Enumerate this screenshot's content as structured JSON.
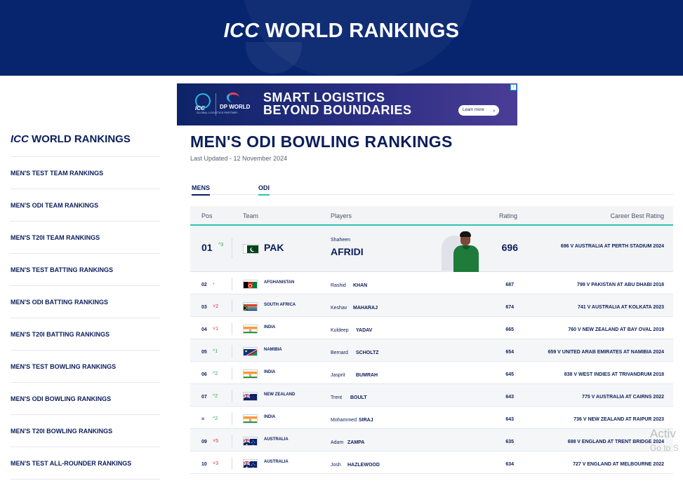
{
  "header": {
    "title_italic": "ICC",
    "title_rest": " WORLD RANKINGS"
  },
  "ad": {
    "icc_logo_text": "ICC",
    "dp_logo_text": "DP WORLD",
    "partner_text": "GLOBAL LOGISTICS PARTNER",
    "headline_1": "SMART LOGISTICS",
    "headline_2": "BEYOND BOUNDARIES",
    "button_label": "Learn more",
    "brand_colors": {
      "navy": "#0d2467",
      "purple": "#4b3d96",
      "cyan": "#35b3e6",
      "red": "#e0435f"
    }
  },
  "sidebar": {
    "title_italic": "ICC",
    "title_rest": " WORLD RANKINGS",
    "items": [
      {
        "label": "MEN'S TEST TEAM RANKINGS"
      },
      {
        "label": "MEN'S ODI TEAM RANKINGS"
      },
      {
        "label": "MEN'S T20I TEAM RANKINGS"
      },
      {
        "label": "MEN'S TEST BATTING RANKINGS"
      },
      {
        "label": "MEN'S ODI BATTING RANKINGS"
      },
      {
        "label": "MEN'S T20I BATTING RANKINGS"
      },
      {
        "label": "MEN'S TEST BOWLING RANKINGS"
      },
      {
        "label": "MEN'S ODI BOWLING RANKINGS"
      },
      {
        "label": "MEN'S T20I BOWLING RANKINGS"
      },
      {
        "label": "MEN'S TEST ALL-ROUNDER RANKINGS"
      }
    ]
  },
  "main": {
    "title": "MEN'S ODI BOWLING RANKINGS",
    "updated": "Last Updated - 12 November 2024",
    "filters": [
      {
        "label": "MENS"
      },
      {
        "label": "ODI"
      }
    ],
    "columns": {
      "pos": "Pos",
      "team": "Team",
      "players": "Players",
      "rating": "Rating",
      "career": "Career Best Rating"
    },
    "top": {
      "pos": "01",
      "move": "3",
      "move_dir": "up",
      "team": "PAK",
      "flag": "pakistan",
      "first": "Shaheen",
      "last": "AFRIDI",
      "rating": "696",
      "career": "696 V AUSTRALIA AT PERTH STADIUM 2024"
    },
    "rows": [
      {
        "pos": "02",
        "move": "",
        "move_dir": "none",
        "team": "AFGHANISTAN",
        "flag": "afghanistan",
        "first": "Rashid",
        "last": "KHAN",
        "rating": "687",
        "career": "799 V PAKISTAN AT ABU DHABI 2018"
      },
      {
        "pos": "03",
        "move": "2",
        "move_dir": "down",
        "team": "SOUTH AFRICA",
        "flag": "south-africa",
        "first": "Keshav",
        "last": "MAHARAJ",
        "rating": "674",
        "career": "741 V AUSTRALIA AT KOLKATA 2023"
      },
      {
        "pos": "04",
        "move": "1",
        "move_dir": "down",
        "team": "INDIA",
        "flag": "india",
        "first": "Kuldeep",
        "last": "YADAV",
        "rating": "665",
        "career": "760 V NEW ZEALAND AT BAY OVAL 2019"
      },
      {
        "pos": "05",
        "move": "1",
        "move_dir": "up",
        "team": "NAMIBIA",
        "flag": "namibia",
        "first": "Bernard",
        "last": "SCHOLTZ",
        "rating": "654",
        "career": "659 V UNITED ARAB EMIRATES AT NAMIBIA 2024"
      },
      {
        "pos": "06",
        "move": "2",
        "move_dir": "up",
        "team": "INDIA",
        "flag": "india",
        "first": "Jasprit",
        "last": "BUMRAH",
        "rating": "645",
        "career": "838 V WEST INDIES AT TRIVANDRUM 2018"
      },
      {
        "pos": "07",
        "move": "2",
        "move_dir": "up",
        "team": "NEW ZEALAND",
        "flag": "new-zealand",
        "first": "Trent",
        "last": "BOULT",
        "rating": "643",
        "career": "775 V AUSTRALIA AT CAIRNS 2022"
      },
      {
        "pos": "=",
        "move": "2",
        "move_dir": "up",
        "team": "INDIA",
        "flag": "india",
        "first": "Mohammed",
        "last": "SIRAJ",
        "rating": "643",
        "career": "736 V NEW ZEALAND AT RAIPUR 2023"
      },
      {
        "pos": "09",
        "move": "5",
        "move_dir": "down",
        "team": "AUSTRALIA",
        "flag": "australia",
        "first": "Adam",
        "last": "ZAMPA",
        "rating": "635",
        "career": "698 V ENGLAND AT TRENT BRIDGE 2024"
      },
      {
        "pos": "10",
        "move": "3",
        "move_dir": "down",
        "team": "AUSTRALIA",
        "flag": "australia",
        "first": "Josh",
        "last": "HAZLEWOOD",
        "rating": "634",
        "career": "727 V ENGLAND AT MELBOURNE 2022"
      }
    ]
  },
  "watermark": {
    "line1": "Activ",
    "line2": "Go to S"
  },
  "colors": {
    "navy": "#07256f",
    "text": "#0b1e5b",
    "teal": "#2ec4b6",
    "up": "#2aa84a",
    "down": "#d42f2f"
  }
}
